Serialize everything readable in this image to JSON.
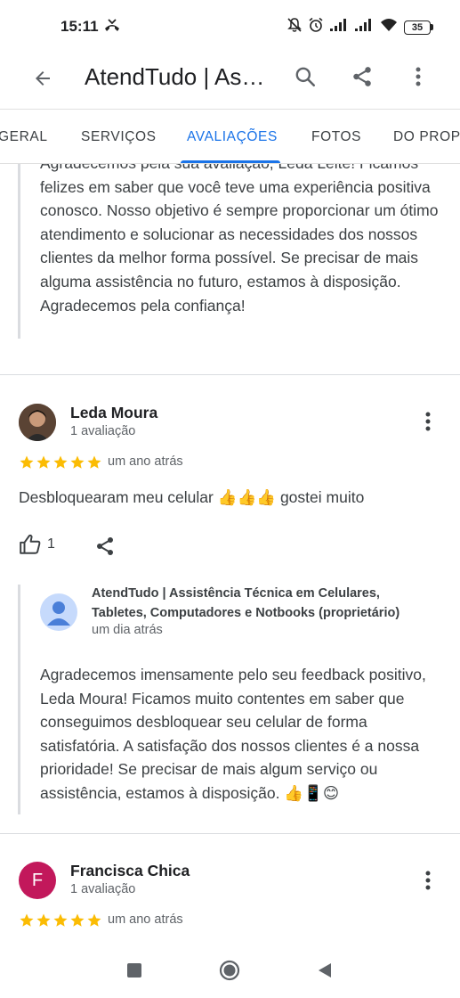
{
  "status_bar": {
    "time": "15:11",
    "battery": "35"
  },
  "app_bar": {
    "title": "AtendTudo | Assistência Técnica em Celulares, Tabletes, Computadores e Notbooks"
  },
  "tabs": [
    {
      "label": "GERAL",
      "active": false
    },
    {
      "label": "SERVIÇOS",
      "active": false
    },
    {
      "label": "AVALIAÇÕES",
      "active": true
    },
    {
      "label": "FOTOS",
      "active": false
    },
    {
      "label": "DO PROPRIETÁRIO",
      "active": false
    }
  ],
  "previous_owner_reply": {
    "text": "Agradecemos pela sua avaliação, Leda Leite! Ficamos felizes em saber que você teve uma experiência positiva conosco. Nosso objetivo é sempre proporcionar um ótimo atendimento e solucionar as necessidades dos nossos clientes da melhor forma possível. Se precisar de mais alguma assistência no futuro, estamos à disposição. Agradecemos pela confiança!"
  },
  "reviews": [
    {
      "name": "Leda Moura",
      "meta": "1 avaliação",
      "rating": 5,
      "date": "um ano atrás",
      "text": "Desbloquearam meu celular 👍👍👍 gostei muito",
      "likes": "1",
      "owner_reply": {
        "name": "AtendTudo | Assistência Técnica em Celulares, Tabletes, Computadores e Notbooks (proprietário)",
        "date": "um dia atrás",
        "text": "Agradecemos imensamente pelo seu feedback positivo, Leda Moura! Ficamos muito contentes em saber que conseguimos desbloquear seu celular de forma satisfatória. A satisfação dos nossos clientes é a nossa prioridade! Se precisar de mais algum serviço ou assistência, estamos à disposição. 👍📱😊"
      }
    },
    {
      "name": "Francisca Chica",
      "initial": "F",
      "meta": "1 avaliação",
      "rating": 5,
      "date": "um ano atrás"
    }
  ],
  "colors": {
    "accent": "#1a73e8",
    "star": "#fbbc04",
    "avatar_francisca": "#c2185b"
  }
}
